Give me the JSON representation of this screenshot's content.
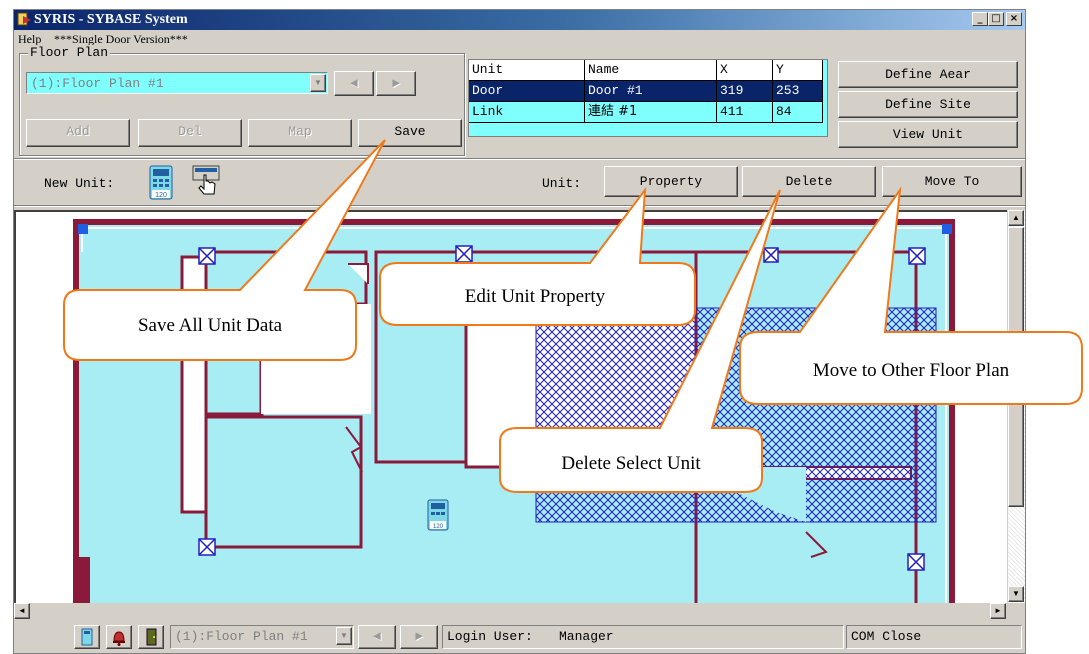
{
  "window": {
    "title": "SYRIS - SYBASE System",
    "controls": {
      "minimize": "_",
      "maximize": "□",
      "close": "×"
    }
  },
  "menu": [
    "Help",
    "***Single Door Version***"
  ],
  "floor_plan": {
    "group_label": "Floor Plan",
    "selected": "(1):Floor Plan #1",
    "prev_icon": "◄",
    "next_icon": "►",
    "buttons": {
      "add": "Add",
      "del": "Del",
      "map": "Map",
      "save": "Save"
    }
  },
  "unit_table": {
    "headers": [
      "Unit",
      "Name",
      "X",
      "Y"
    ],
    "rows": [
      {
        "unit": "Door",
        "name": "Door #1",
        "x": "319",
        "y": "253",
        "selected": true
      },
      {
        "unit": "Link",
        "name": "連結 #1",
        "x": "411",
        "y": "84",
        "selected": false
      }
    ]
  },
  "side_buttons": {
    "define_area": "Define Aear",
    "define_site": "Define Site",
    "view_unit": "View Unit"
  },
  "unit_toolbar": {
    "new_unit_label": "New Unit:",
    "unit_label": "Unit:",
    "property": "Property",
    "delete": "Delete",
    "move_to": "Move To",
    "icons": [
      "controller-icon",
      "door-pointer-icon"
    ]
  },
  "callouts": {
    "save": "Save All Unit Data",
    "property": "Edit Unit Property",
    "delete": "Delete Select Unit",
    "move": "Move to Other Floor Plan"
  },
  "status_bar": {
    "floor_plan": "(1):Floor Plan #1",
    "login_label": "Login User:",
    "login_user": "Manager",
    "com_status": "COM Close"
  },
  "colors": {
    "map_fill": "#a8ecf4",
    "wall": "#8b1a3a",
    "hatch": "#2020c0",
    "selection": "#0a246a",
    "callout_stroke": "#f07a1a"
  }
}
